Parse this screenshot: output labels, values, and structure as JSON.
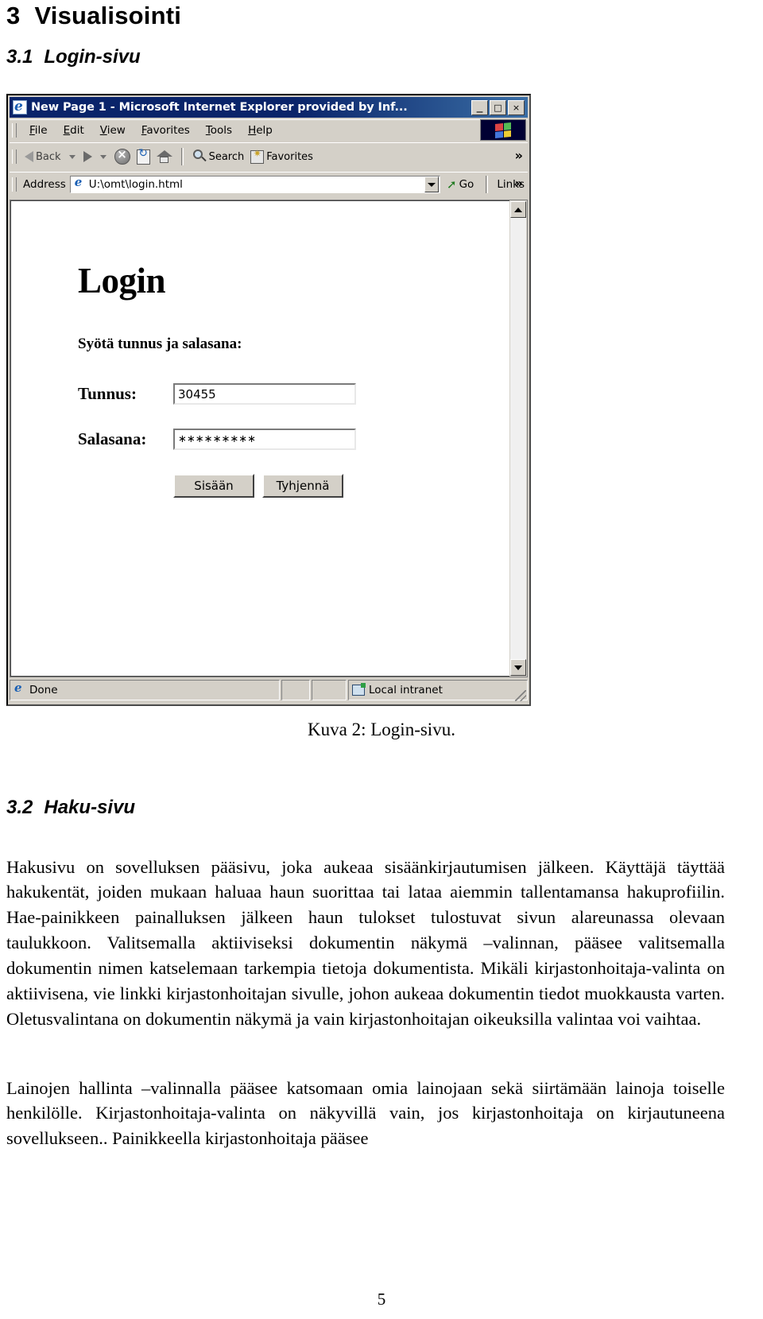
{
  "document": {
    "section_3": {
      "number": "3",
      "title": "Visualisointi"
    },
    "section_3_1": {
      "number": "3.1",
      "title": "Login-sivu"
    },
    "section_3_2": {
      "number": "3.2",
      "title": "Haku-sivu"
    },
    "figure_caption": "Kuva 2: Login-sivu.",
    "page_number": "5",
    "paragraph_1": "Hakusivu on sovelluksen pääsivu, joka aukeaa sisäänkirjautumisen jälkeen. Käyttäjä täyttää hakukentät, joiden mukaan haluaa haun suorittaa tai lataa aiemmin tallentamansa hakuprofiilin. Hae-painikkeen painalluksen jälkeen haun tulokset tulostuvat sivun alareunassa olevaan taulukkoon. Valitsemalla aktiiviseksi dokumentin näkymä –valinnan, pääsee valitsemalla dokumentin nimen katselemaan tarkempia tietoja dokumentista. Mikäli kirjastonhoitaja-valinta on aktiivisena, vie linkki kirjastonhoitajan sivulle, johon aukeaa dokumentin tiedot muokkausta varten. Oletusvalintana on dokumentin näkymä ja vain kirjastonhoitajan oikeuksilla valintaa voi vaihtaa.",
    "paragraph_2": "Lainojen hallinta –valinnalla pääsee katsomaan omia lainojaan sekä siirtämään lainoja toiselle henkilölle. Kirjastonhoitaja-valinta on näkyvillä vain, jos kirjastonhoitaja on kirjautuneena sovellukseen.. Painikkeella kirjastonhoitaja pääsee"
  },
  "browser": {
    "titlebar": {
      "title": "New Page 1 - Microsoft Internet Explorer provided by Inf...",
      "minimize": "_",
      "maximize": "□",
      "close": "×"
    },
    "menubar": [
      {
        "label": "File",
        "accel": "F",
        "rest": "ile"
      },
      {
        "label": "Edit",
        "accel": "E",
        "rest": "dit"
      },
      {
        "label": "View",
        "accel": "V",
        "rest": "iew"
      },
      {
        "label": "Favorites",
        "accel": "F",
        "rest": "avorites"
      },
      {
        "label": "Tools",
        "accel": "T",
        "rest": "ools"
      },
      {
        "label": "Help",
        "accel": "H",
        "rest": "elp"
      }
    ],
    "toolbar": {
      "back": "Back",
      "forward": "",
      "stop": "",
      "refresh": "",
      "home": "",
      "search": "Search",
      "favorites": "Favorites",
      "overflow": "»"
    },
    "addressbar": {
      "label": "Address",
      "value": "U:\\omt\\login.html",
      "go": "Go",
      "links": "Links",
      "overflow": "»"
    },
    "statusbar": {
      "status": "Done",
      "zone": "Local intranet"
    }
  },
  "login_page": {
    "heading": "Login",
    "subheading": "Syötä tunnus ja salasana:",
    "fields": [
      {
        "label": "Tunnus:",
        "value": "30455",
        "type": "text"
      },
      {
        "label": "Salasana:",
        "value": "∗∗∗∗∗∗∗∗∗",
        "type": "password"
      }
    ],
    "buttons": [
      {
        "label": "Sisään"
      },
      {
        "label": "Tyhjennä"
      }
    ]
  }
}
